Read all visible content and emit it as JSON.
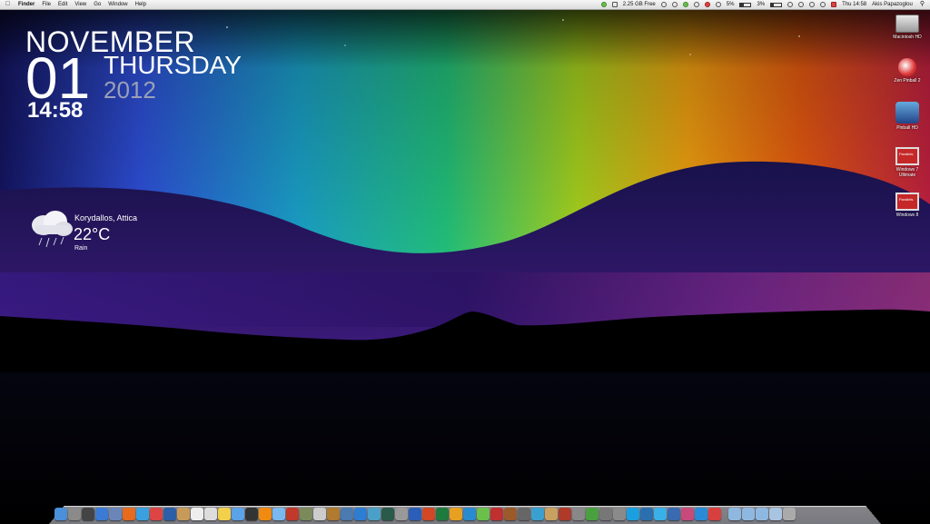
{
  "menubar": {
    "active_app": "Finder",
    "menus": [
      "File",
      "Edit",
      "View",
      "Go",
      "Window",
      "Help"
    ],
    "disk_free": "2.25 GB Free",
    "battery_percent_a": "5%",
    "battery_percent_b": "3%",
    "clock": "Thu 14:58",
    "user": "Akis Papazoglou"
  },
  "clock_widget": {
    "month": "NOVEMBER",
    "day": "01",
    "weekday": "THURSDAY",
    "year": "2012",
    "time": "14:58"
  },
  "weather_widget": {
    "location": "Korydallos, Attica",
    "temperature": "22°C",
    "condition": "Rain",
    "icon": "rain-cloud-icon"
  },
  "desktop_icons": [
    {
      "label": "Macintosh HD",
      "icon": "hard-drive-icon"
    },
    {
      "label": "Zen Pinball 2",
      "icon": "pinball-icon"
    },
    {
      "label": "Pinball HD",
      "icon": "pinball-hd-icon"
    },
    {
      "label": "Windows 7 Ultimate",
      "icon": "parallels-vm-icon"
    },
    {
      "label": "Windows 8",
      "icon": "parallels-vm-icon"
    }
  ],
  "dock": {
    "apps": [
      {
        "icon": "finder-icon",
        "color": "#4a8fd8"
      },
      {
        "icon": "launchpad-icon",
        "color": "#8a8a8a"
      },
      {
        "icon": "mission-control-icon",
        "color": "#444"
      },
      {
        "icon": "app-store-icon",
        "color": "#3b7bd6"
      },
      {
        "icon": "preview-icon",
        "color": "#6a86b8"
      },
      {
        "icon": "firefox-icon",
        "color": "#e76b1c"
      },
      {
        "icon": "safari-icon",
        "color": "#3aa0e0"
      },
      {
        "icon": "chrome-icon",
        "color": "#d44"
      },
      {
        "icon": "quicktime-icon",
        "color": "#2c5fa8"
      },
      {
        "icon": "contacts-icon",
        "color": "#c89a5a"
      },
      {
        "icon": "calendar-icon",
        "color": "#eee"
      },
      {
        "icon": "textedit-icon",
        "color": "#ddd"
      },
      {
        "icon": "stickies-icon",
        "color": "#f2d04a"
      },
      {
        "icon": "itunes-icon",
        "color": "#5aa3e8"
      },
      {
        "icon": "photo-booth-icon",
        "color": "#333"
      },
      {
        "icon": "vlc-icon",
        "color": "#f08a10"
      },
      {
        "icon": "messages-icon",
        "color": "#7ab8f0"
      },
      {
        "icon": "photo-icon",
        "color": "#c0392b"
      },
      {
        "icon": "iphoto-icon",
        "color": "#7a8a5a"
      },
      {
        "icon": "garageband-icon",
        "color": "#ccc"
      },
      {
        "icon": "guitar-icon",
        "color": "#b07a30"
      },
      {
        "icon": "xcode-icon",
        "color": "#4a7ab0"
      },
      {
        "icon": "utility-icon",
        "color": "#2d7dd2"
      },
      {
        "icon": "network-icon",
        "color": "#4aa0c8"
      },
      {
        "icon": "time-machine-icon",
        "color": "#2a5a4a"
      },
      {
        "icon": "disk-utility-icon",
        "color": "#999"
      },
      {
        "icon": "word-icon",
        "color": "#2b5eb8"
      },
      {
        "icon": "powerpoint-icon",
        "color": "#d24726"
      },
      {
        "icon": "excel-icon",
        "color": "#1f7a3e"
      },
      {
        "icon": "outlook-icon",
        "color": "#e8a020"
      },
      {
        "icon": "lync-icon",
        "color": "#2a8ad0"
      },
      {
        "icon": "messenger-icon",
        "color": "#6ac04a"
      },
      {
        "icon": "transmission-icon",
        "color": "#c03030"
      },
      {
        "icon": "coffee-icon",
        "color": "#9a5a2a"
      },
      {
        "icon": "automator-icon",
        "color": "#666"
      },
      {
        "icon": "script-icon",
        "color": "#3aa0d0"
      },
      {
        "icon": "archive-icon",
        "color": "#c8a060"
      },
      {
        "icon": "toolbox-icon",
        "color": "#b03a2a"
      },
      {
        "icon": "uninstall-icon",
        "color": "#888"
      },
      {
        "icon": "utorrent-icon",
        "color": "#4aa040"
      },
      {
        "icon": "keyboard-icon",
        "color": "#777"
      },
      {
        "icon": "system-prefs-icon",
        "color": "#8a8a8a"
      },
      {
        "icon": "skype-icon",
        "color": "#1aa0e0"
      },
      {
        "icon": "google-earth-icon",
        "color": "#2a70b0"
      },
      {
        "icon": "twitter-icon",
        "color": "#3ab0e8"
      },
      {
        "icon": "screen-sharing-icon",
        "color": "#3a6ab0"
      },
      {
        "icon": "photo-booth-icon-2",
        "color": "#c84a7a"
      },
      {
        "icon": "ie-icon",
        "color": "#2a8ad8"
      },
      {
        "icon": "parallels-icon",
        "color": "#d84040"
      }
    ],
    "folders": [
      {
        "icon": "applications-folder-icon",
        "color": "#8fb8e0"
      },
      {
        "icon": "documents-folder-icon",
        "color": "#8fb8e0"
      },
      {
        "icon": "downloads-folder-icon",
        "color": "#8fb8e0"
      },
      {
        "icon": "stack-folder-icon",
        "color": "#a8c4e0"
      },
      {
        "icon": "trash-icon",
        "color": "#aaa"
      }
    ]
  }
}
